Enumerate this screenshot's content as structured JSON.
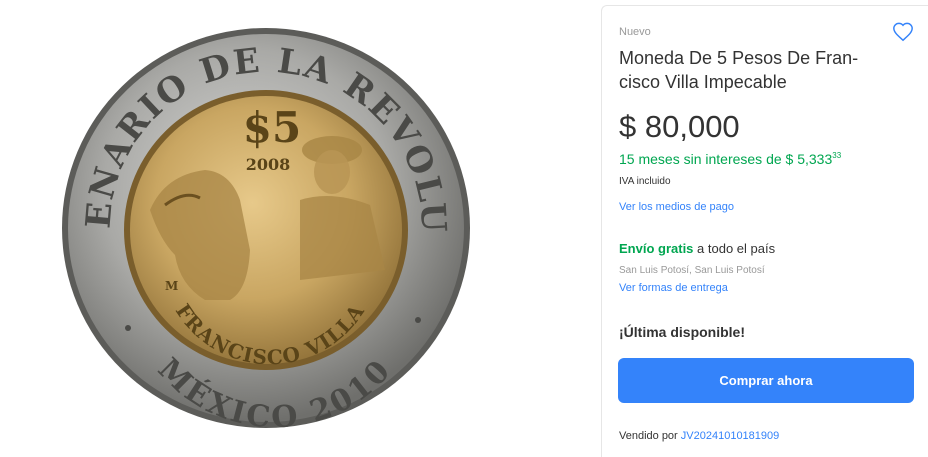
{
  "product": {
    "image_alt": "Moneda de 5 pesos Francisco Villa",
    "coin_text": {
      "outer_ring_top": "CENTENARIO DE LA REVOLUCIÓN",
      "outer_ring_bottom": "MÉXICO 2010",
      "denomination": "$5",
      "year": "2008",
      "name": "FRANCISCO VILLA",
      "mint_mark": "M"
    },
    "condition": "Nuevo",
    "title": "Moneda De 5 Pesos De Fran-cisco Villa Impecable",
    "title_line1": "Moneda De 5 Pesos De Fran-",
    "title_line2": "cisco Villa Impecable",
    "price": "$ 80,000",
    "installments_text": "15 meses sin intereses de $ 5,333",
    "installments_cents": "33",
    "tax_note": "IVA incluido",
    "payment_link": "Ver los medios de pago",
    "shipping_free": "Envío gratis",
    "shipping_rest": " a todo el país",
    "location": "San Luis Potosí, San Luis Potosí",
    "delivery_link": "Ver formas de entrega",
    "stock": "¡Última disponible!",
    "buy_button": "Comprar ahora",
    "seller_prefix": "Vendido por ",
    "seller_name": "JV20241010181909"
  },
  "colors": {
    "accent": "#3483fa",
    "green": "#00a650",
    "muted": "#999999",
    "text": "#333333"
  },
  "icons": {
    "favorite": "heart-outline-icon"
  }
}
